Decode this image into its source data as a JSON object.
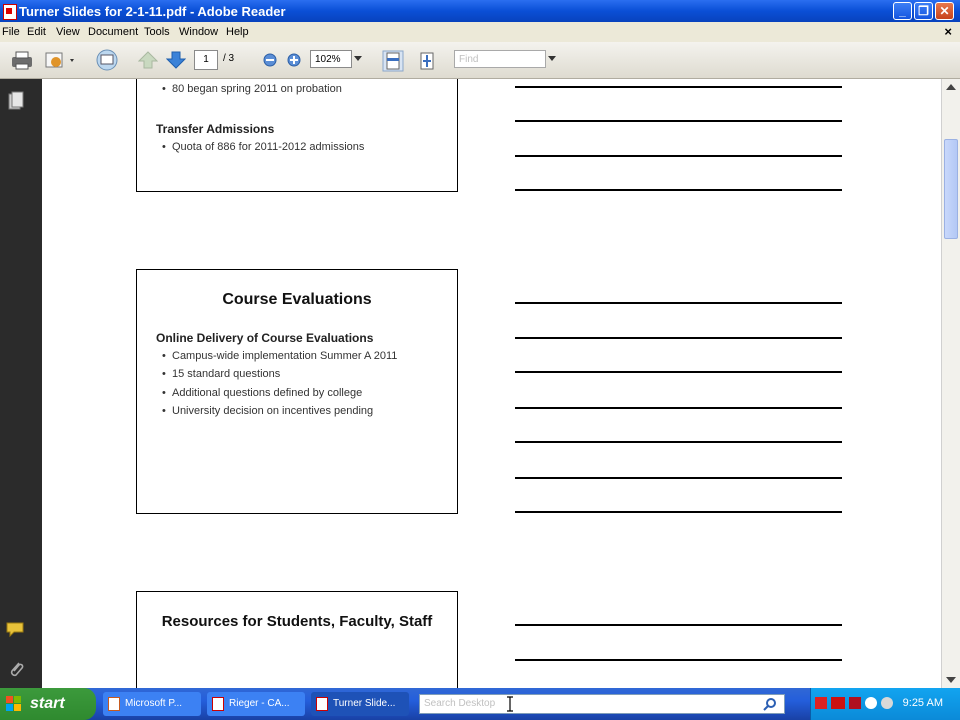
{
  "window": {
    "title": "Turner Slides for 2-1-11.pdf - Adobe Reader"
  },
  "menu": [
    "File",
    "Edit",
    "View",
    "Document",
    "Tools",
    "Window",
    "Help"
  ],
  "menu_close": "×",
  "toolbar": {
    "page_current": "1",
    "page_total": "/ 3",
    "zoom": "102%",
    "find_placeholder": "Find"
  },
  "slides": {
    "slide1": {
      "bullet_top": "80 began spring 2011 on probation",
      "section": "Transfer Admissions",
      "bullets": [
        "Quota of 886 for 2011-2012 admissions"
      ]
    },
    "slide2": {
      "title": "Course Evaluations",
      "section": "Online Delivery of Course Evaluations",
      "bullets": [
        "Campus-wide implementation Summer A 2011",
        "15 standard questions",
        "Additional questions defined by college",
        "University decision on incentives pending"
      ]
    },
    "slide3": {
      "title": "Resources for Students, Faculty, Staff"
    }
  },
  "taskbar": {
    "start": "start",
    "tasks": [
      "Microsoft P...",
      "Rieger - CA...",
      "Turner Slide..."
    ],
    "search_placeholder": "Search Desktop",
    "clock": "9:25 AM"
  },
  "colors": {
    "titlebar": "#0a4fd6",
    "taskbar": "#245edb",
    "start": "#3c9a3c",
    "sidebar": "#2b2b2b"
  }
}
